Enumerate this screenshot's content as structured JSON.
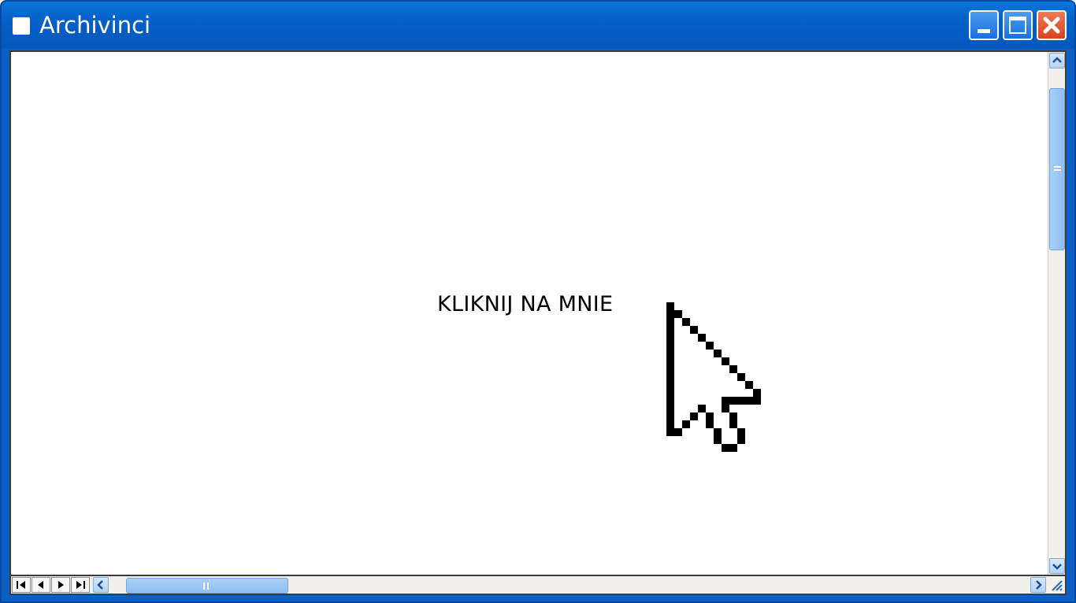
{
  "window": {
    "title": "Archivinci",
    "buttons": [
      "minimize-icon",
      "maximize-icon",
      "close-icon"
    ]
  },
  "content": {
    "label": "KLIKNIJ NA MNIE",
    "illustration": "pixel-arrow-cursor-icon"
  },
  "scrollbars": {
    "vertical": "visible",
    "horizontal": "visible"
  },
  "colors": {
    "titlebar": "#0560c8",
    "close_button": "#d8421e",
    "scroll_thumb": "#8ec0f2"
  }
}
